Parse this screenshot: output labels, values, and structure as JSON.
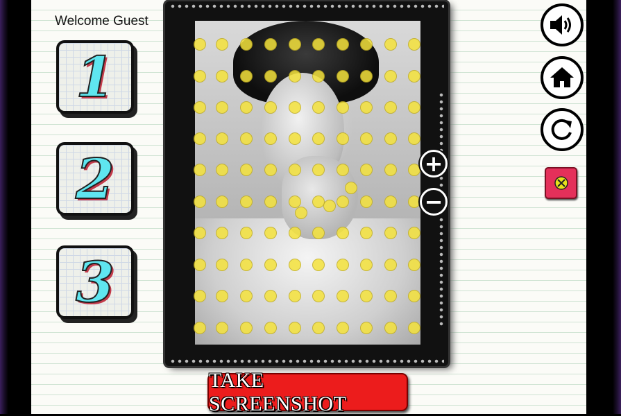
{
  "header": {
    "welcome_text": "Welcome Guest"
  },
  "levels": [
    {
      "label": "1",
      "name": "level-1-button"
    },
    {
      "label": "2",
      "name": "level-2-button"
    },
    {
      "label": "3",
      "name": "level-3-button"
    }
  ],
  "puzzle": {
    "image_subject": "black-and-white portrait photo",
    "dot_color": "#f5e33c",
    "zoom_in_symbol": "+",
    "zoom_out_symbol": "−"
  },
  "controls": {
    "sound_icon": "speaker-icon",
    "home_icon": "home-icon",
    "restart_icon": "restart-icon",
    "close_icon": "close-icon"
  },
  "actions": {
    "screenshot_label": "TAKE SCREENSHOT"
  },
  "colors": {
    "screenshot_button": "#ec1c1c",
    "close_button": "#e4305a",
    "level_digit": "#5fe6f0"
  }
}
